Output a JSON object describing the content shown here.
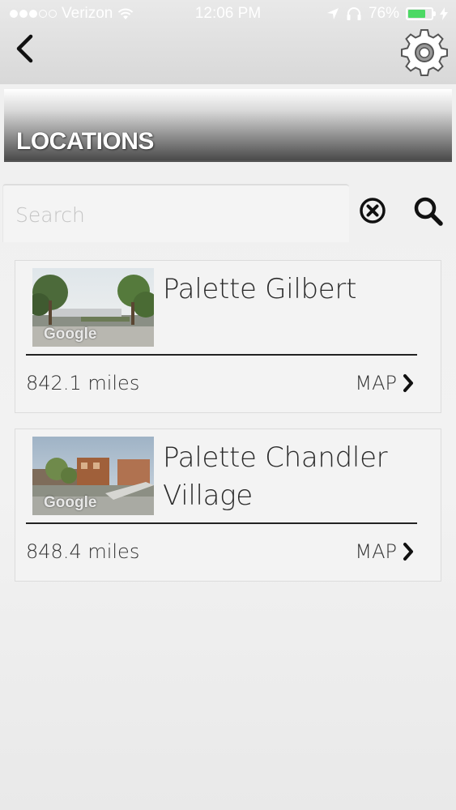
{
  "status_bar": {
    "carrier": "Verizon",
    "time": "12:06 PM",
    "battery": "76%",
    "battery_level": 0.76,
    "signal_bars": 3,
    "signal_total": 5
  },
  "nav": {
    "back_icon": "chevron-left-icon",
    "settings_icon": "gear-icon"
  },
  "header": {
    "title": "LOCATIONS"
  },
  "search": {
    "placeholder": "Search",
    "value": "",
    "clear_icon": "clear-circle-icon",
    "search_icon": "search-icon"
  },
  "locations": [
    {
      "name": "Palette Gilbert",
      "distance": "842.1 miles",
      "map_label": "MAP",
      "thumbnail_watermark": "Google"
    },
    {
      "name": "Palette Chandler Village",
      "distance": "848.4 miles",
      "map_label": "MAP",
      "thumbnail_watermark": "Google"
    }
  ],
  "colors": {
    "battery_fill": "#4cd964",
    "header_dark": "#4a4a4a",
    "divider": "#222222"
  }
}
